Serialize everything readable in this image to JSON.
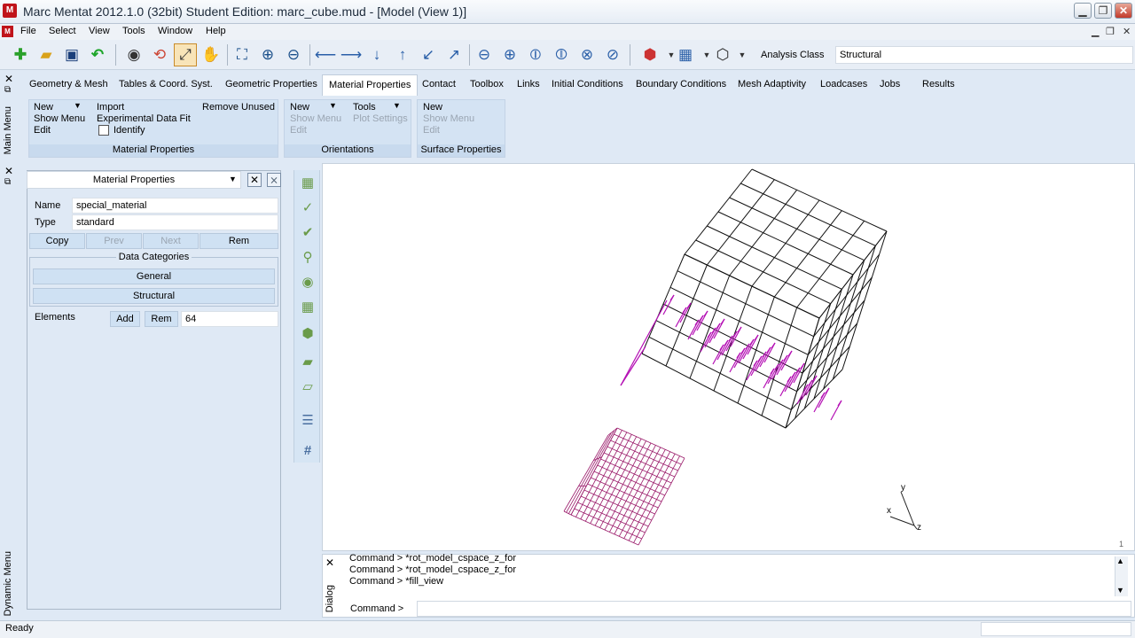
{
  "window": {
    "title": "Marc Mentat 2012.1.0 (32bit) Student Edition: marc_cube.mud - [Model (View 1)]",
    "app_icon": "M",
    "minimize": "▁",
    "maximize": "❐",
    "close": "✕"
  },
  "menu": {
    "items": [
      "File",
      "Select",
      "View",
      "Tools",
      "Window",
      "Help"
    ],
    "mdi_min": "▁",
    "mdi_restore": "❐",
    "mdi_close": "✕"
  },
  "toolbar": {
    "icons": [
      "new-file-icon",
      "open-folder-icon",
      "save-icon",
      "undo-icon",
      "eye-icon",
      "rotate-reset-icon",
      "fill-view-icon",
      "pan-hand-icon",
      "zoom-box-icon",
      "zoom-in-icon",
      "zoom-out-icon",
      "move-left-icon",
      "move-right-icon",
      "move-down-icon",
      "move-up-icon",
      "move-diag-in-icon",
      "move-diag-out-icon",
      "rotate-x-neg-icon",
      "rotate-x-pos-icon",
      "rotate-y-neg-icon",
      "rotate-y-pos-icon",
      "rotate-z-neg-icon",
      "rotate-z-pos-icon",
      "render-cube-icon",
      "mesh-grid-icon",
      "wire-cube-icon"
    ],
    "analysis_label": "Analysis Class",
    "analysis_value": "Structural"
  },
  "side_labels": {
    "main_menu": "Main Menu",
    "dynamic_menu": "Dynamic Menu",
    "dialog": "Dialog"
  },
  "tabs": [
    "Geometry & Mesh",
    "Tables & Coord. Syst.",
    "Geometric Properties",
    "Material Properties",
    "Contact",
    "Toolbox",
    "Links",
    "Initial Conditions",
    "Boundary Conditions",
    "Mesh Adaptivity",
    "Loadcases",
    "Jobs",
    "Results"
  ],
  "ribbon": {
    "material": {
      "caption": "Material Properties",
      "new": "New",
      "show_menu": "Show Menu",
      "edit": "Edit",
      "import": "Import",
      "exp_fit": "Experimental Data Fit",
      "identify": "Identify",
      "remove_unused": "Remove Unused"
    },
    "orientations": {
      "caption": "Orientations",
      "new": "New",
      "show_menu": "Show Menu",
      "edit": "Edit",
      "tools": "Tools",
      "plot_settings": "Plot Settings"
    },
    "surface": {
      "caption": "Surface Properties",
      "new": "New",
      "show_menu": "Show Menu",
      "edit": "Edit"
    }
  },
  "panel": {
    "header": "Material Properties",
    "name_label": "Name",
    "name_value": "special_material",
    "type_label": "Type",
    "type_value": "standard",
    "copy": "Copy",
    "prev": "Prev",
    "next": "Next",
    "rem": "Rem",
    "data_categories": "Data Categories",
    "general": "General",
    "structural": "Structural",
    "elements_label": "Elements",
    "add": "Add",
    "elements_rem": "Rem",
    "elements_count": "64"
  },
  "viewport": {
    "axis_x": "x",
    "axis_y": "y",
    "axis_z": "z",
    "corner_index": "1"
  },
  "dialog": {
    "lines": [
      "Command > *rot_model_cspace_z_for",
      "Command > *rot_model_cspace_z_for",
      "Command > *fill_view"
    ],
    "prompt": "Command >",
    "close": "✕"
  },
  "status": {
    "text": "Ready"
  }
}
